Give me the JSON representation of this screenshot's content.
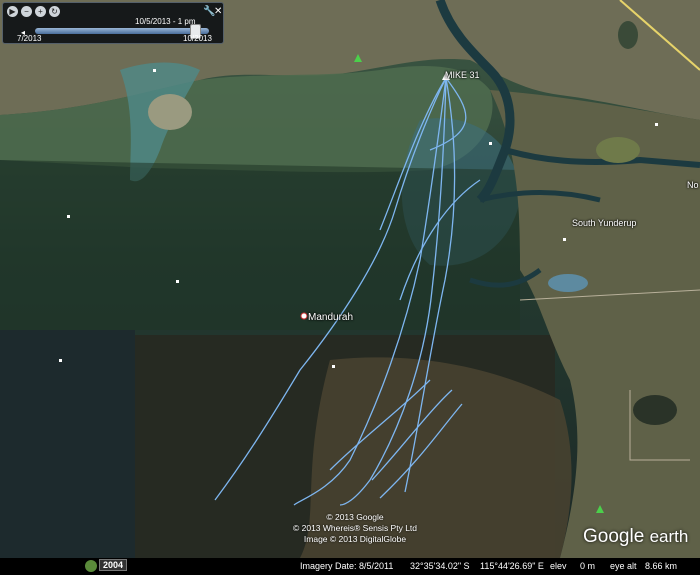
{
  "time_slider": {
    "current": "10/5/2013 - 1 pm",
    "start": "7/2013",
    "end": "10/2013",
    "progress": 0.92
  },
  "places": {
    "mike31": "MIKE 31",
    "mandurah": "Mandurah",
    "south_yunderup": "South Yunderup",
    "no": "No"
  },
  "credits": [
    "© 2013 Google",
    "© 2013 Whereis® Sensis Pty Ltd",
    "Image © 2013 DigitalGlobe"
  ],
  "footer": {
    "year": "2004",
    "imagery_date": "Imagery Date: 8/5/2011",
    "lat": "32°35'34.02\" S",
    "lon": "115°44'26.69\" E",
    "elev_label": "elev",
    "elev_value": "0 m",
    "eye_alt_label": "eye alt",
    "eye_alt_value": "8.66 km"
  },
  "logo": {
    "google": "Google",
    "earth": "earth"
  },
  "icons": {
    "play": "play-icon",
    "zoom_out": "zoom-out-icon",
    "zoom_in": "zoom-in-icon",
    "loop": "loop-icon",
    "wrench": "wrench-icon",
    "close": "close-icon"
  },
  "colors": {
    "track": "#7eb6f0",
    "water_dark": "#1f2a28",
    "land": "#7c7a5c"
  }
}
